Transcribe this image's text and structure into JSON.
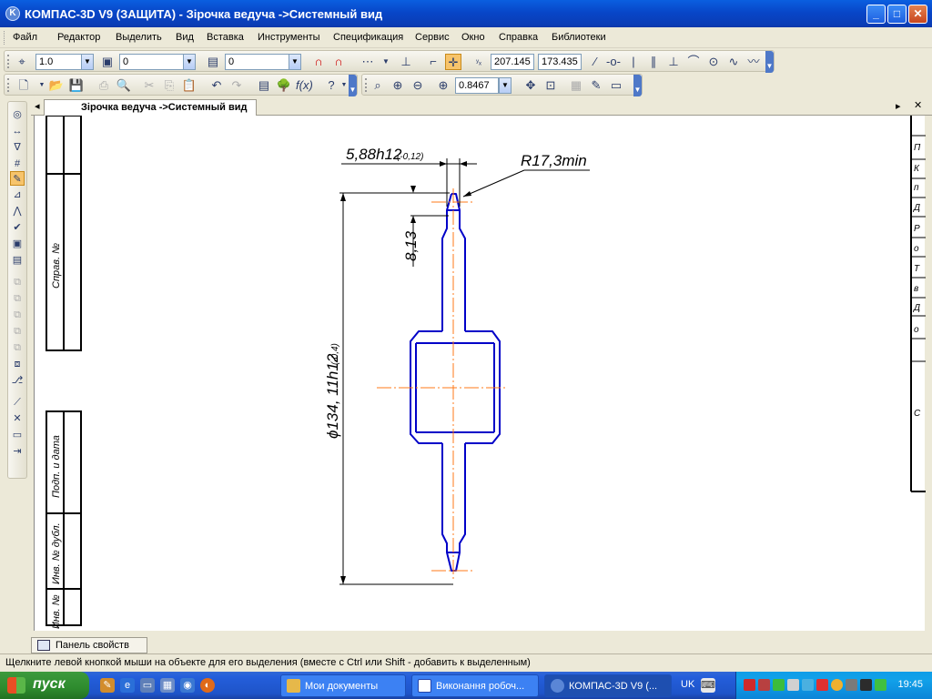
{
  "window": {
    "title": "КОМПАС-3D V9 (ЗАЩИТА) - Зірочка ведуча ->Системный вид",
    "app_icon": "kompas-icon",
    "buttons": [
      "minimize-icon",
      "maximize-icon",
      "close-icon"
    ]
  },
  "menu": [
    "Файл",
    "Редактор",
    "Выделить",
    "Вид",
    "Вставка",
    "Инструменты",
    "Спецификация",
    "Сервис",
    "Окно",
    "Справка",
    "Библиотеки"
  ],
  "toolbar1": {
    "line_scale": "1.0",
    "layer": "0",
    "style": "0",
    "coord_x": "207.145",
    "coord_y": "173.435"
  },
  "toolbar2": {
    "zoom": "0.8467"
  },
  "document": {
    "tab": "Зірочка ведуча ->Системный вид"
  },
  "drawing": {
    "dim_width": "5,88h12",
    "dim_width_tol": "(-0,12)",
    "dim_radius": "R17,3min",
    "dim_height": "8,13",
    "dim_diameter": "ϕ134, 11h12",
    "dim_diameter_tol": "(-0,4)",
    "frame_labels": [
      "Справ. №",
      "Подп. и дата",
      "Инв. № дубл.",
      "Инв. №"
    ],
    "right_table": [
      "П",
      "К",
      "п",
      "Д",
      "Р",
      "о",
      "Т",
      "в",
      "Д",
      "о",
      "С"
    ]
  },
  "property_panel": "Панель свойств",
  "status": "Щелкните левой кнопкой мыши на объекте для его выделения (вместе с Ctrl или Shift - добавить к выделенным)",
  "taskbar": {
    "start": "пуск",
    "tasks": [
      "Мои документы",
      "Виконання робоч...",
      "КОМПАС-3D V9 (..."
    ],
    "language": "UK",
    "time": "19:45"
  },
  "colors": {
    "outline": "#0000c8",
    "centerline": "#ff7a1a",
    "dimension": "#000000"
  }
}
